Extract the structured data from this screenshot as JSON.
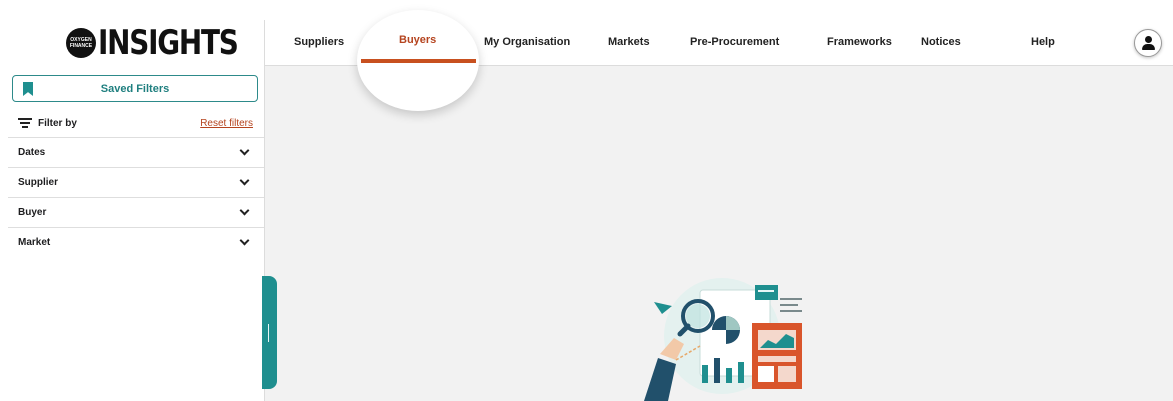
{
  "brand": {
    "badge_line1": "OXYGEN",
    "badge_line2": "FINANCE",
    "name": "INSIGHTS"
  },
  "sidebar": {
    "saved_filters_label": "Saved Filters",
    "filter_by_label": "Filter by",
    "reset_filters_label": "Reset filters",
    "accordions": [
      {
        "label": "Dates"
      },
      {
        "label": "Supplier"
      },
      {
        "label": "Buyer"
      },
      {
        "label": "Market"
      }
    ]
  },
  "nav": {
    "items": [
      {
        "label": "Suppliers"
      },
      {
        "label": "Buyers",
        "active": true
      },
      {
        "label": "My Organisation"
      },
      {
        "label": "Markets"
      },
      {
        "label": "Pre-Procurement"
      },
      {
        "label": "Frameworks"
      },
      {
        "label": "Notices"
      },
      {
        "label": "Help"
      }
    ]
  },
  "colors": {
    "accent_teal": "#1f8f8f",
    "active_orange": "#c8501f",
    "reset_link": "#b5441f"
  },
  "icons": [
    "bookmark-icon",
    "filter-icon",
    "chevron-down-icon",
    "user-icon",
    "analytics-illustration"
  ]
}
